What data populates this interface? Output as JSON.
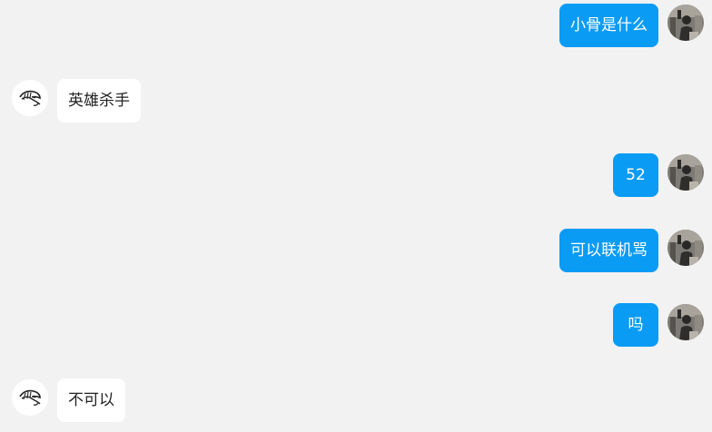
{
  "messages": [
    {
      "direction": "out",
      "text": "小骨是什么",
      "avatar_icon": "user-photo-avatar"
    },
    {
      "direction": "in",
      "text": "英雄杀手",
      "avatar_icon": "sketch-bird-avatar"
    },
    {
      "direction": "out",
      "text": "52",
      "avatar_icon": "user-photo-avatar"
    },
    {
      "direction": "out",
      "text": "可以联机骂",
      "avatar_icon": "user-photo-avatar"
    },
    {
      "direction": "out",
      "text": "吗",
      "avatar_icon": "user-photo-avatar"
    },
    {
      "direction": "in",
      "text": "不可以",
      "avatar_icon": "sketch-bird-avatar"
    }
  ],
  "colors": {
    "background": "#f2f2f2",
    "outgoing_bubble": "#0a9bf5",
    "incoming_bubble": "#ffffff"
  }
}
